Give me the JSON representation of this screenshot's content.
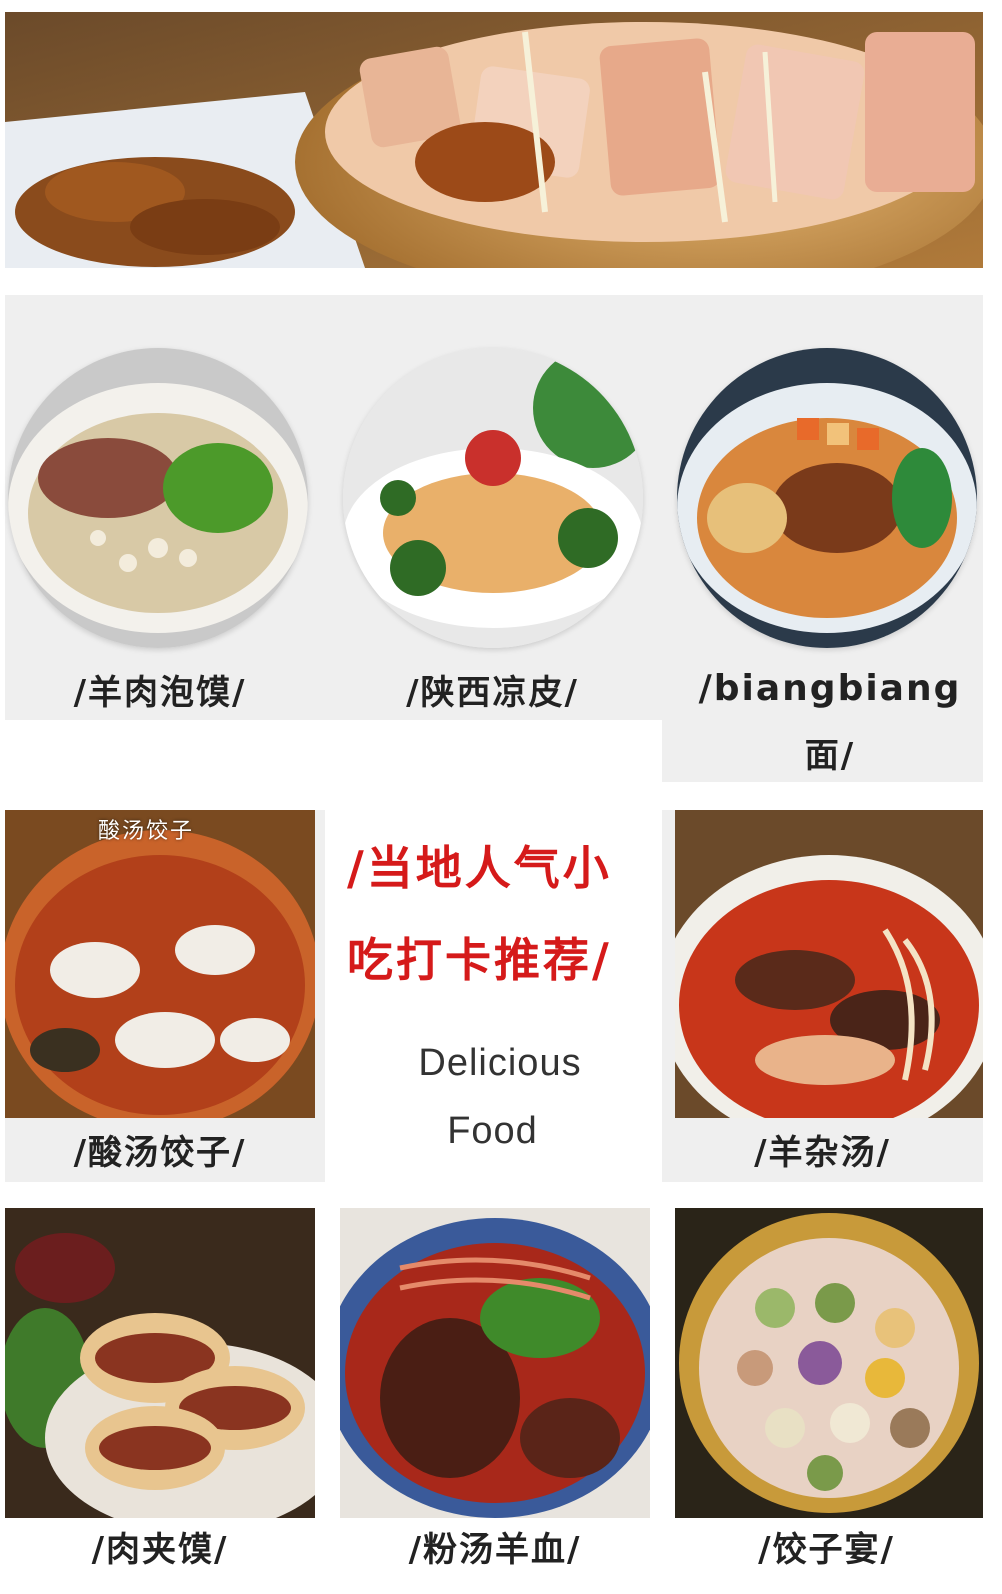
{
  "items": {
    "yangrou_paomo": "/羊肉泡馍/",
    "shaanxi_liangpi": "/陕西凉皮/",
    "biangbiang_line1": "/biangbiang",
    "biangbiang_line2": "面/",
    "suantang_jiaozi": "/酸汤饺子/",
    "yang_zatang": "/羊杂汤/",
    "roujiamo": "/肉夹馍/",
    "fentang_yangxue": "/粉汤羊血/",
    "jiaozi_yan": "/饺子宴/"
  },
  "center": {
    "headline_line1": "/当地人气小",
    "headline_line2": "吃打卡推荐/",
    "sub_line1": "Delicious",
    "sub_line2": "Food"
  },
  "photo_caption": "酸汤饺子",
  "colors": {
    "accent_red": "#d51a1a",
    "panel_gray": "#efefef"
  }
}
